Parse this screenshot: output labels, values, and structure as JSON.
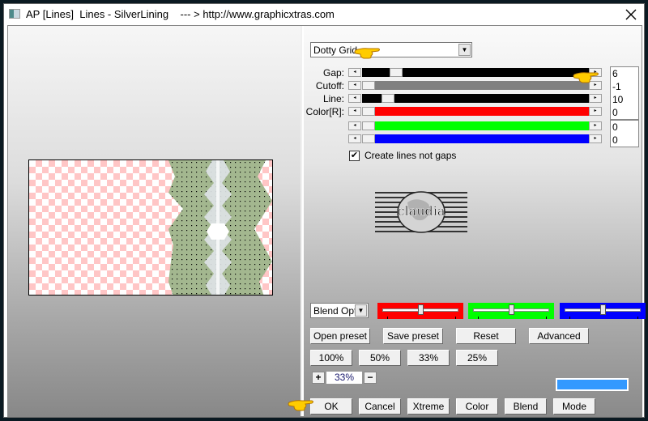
{
  "window": {
    "title": "AP [Lines]  Lines - SilverLining    --- > http://www.graphicxtras.com",
    "icon": "app-icon",
    "close_icon": "close-icon"
  },
  "preview": {
    "description": "Preview of dotty grid lines effect on green zigzag image over transparent checkerboard"
  },
  "controls": {
    "preset_select": {
      "value": "Dotty Grid"
    },
    "sliders": [
      {
        "label": "Gap:",
        "value": "6",
        "track_color": "#000000",
        "thumb_position": 0.1
      },
      {
        "label": "Cutoff:",
        "value": "-1",
        "track_color": "#808080",
        "thumb_position": 0.0
      },
      {
        "label": "Line:",
        "value": "10",
        "track_color": "#000000",
        "thumb_position": 0.06
      },
      {
        "label": "Color[R]:",
        "value": "0",
        "track_color": "#ff0000",
        "thumb_position": 0.0
      },
      {
        "label": "",
        "value": "0",
        "track_color": "#00ff00",
        "thumb_position": 0.0
      },
      {
        "label": "",
        "value": "0",
        "track_color": "#0000ff",
        "thumb_position": 0.0
      }
    ],
    "checkbox": {
      "label": "Create lines not gaps",
      "checked": true
    },
    "blend_select": {
      "value": "Blend Opti"
    },
    "color_sliders": [
      {
        "color": "#ff0000",
        "position": 0.5
      },
      {
        "color": "#00ff00",
        "position": 0.5
      },
      {
        "color": "#0000ff",
        "position": 0.5
      }
    ],
    "preset_buttons": [
      "Open preset",
      "Save preset",
      "Reset",
      "Advanced"
    ],
    "zoom_buttons": [
      "100%",
      "50%",
      "33%",
      "25%"
    ],
    "zoom": {
      "plus": "+",
      "value": "33%",
      "minus": "−"
    },
    "swatch_color": "#3399ff",
    "bottom_buttons": [
      "OK",
      "Cancel",
      "Xtreme",
      "Color",
      "Blend",
      "Mode"
    ]
  },
  "logo": {
    "text": "claudia"
  }
}
